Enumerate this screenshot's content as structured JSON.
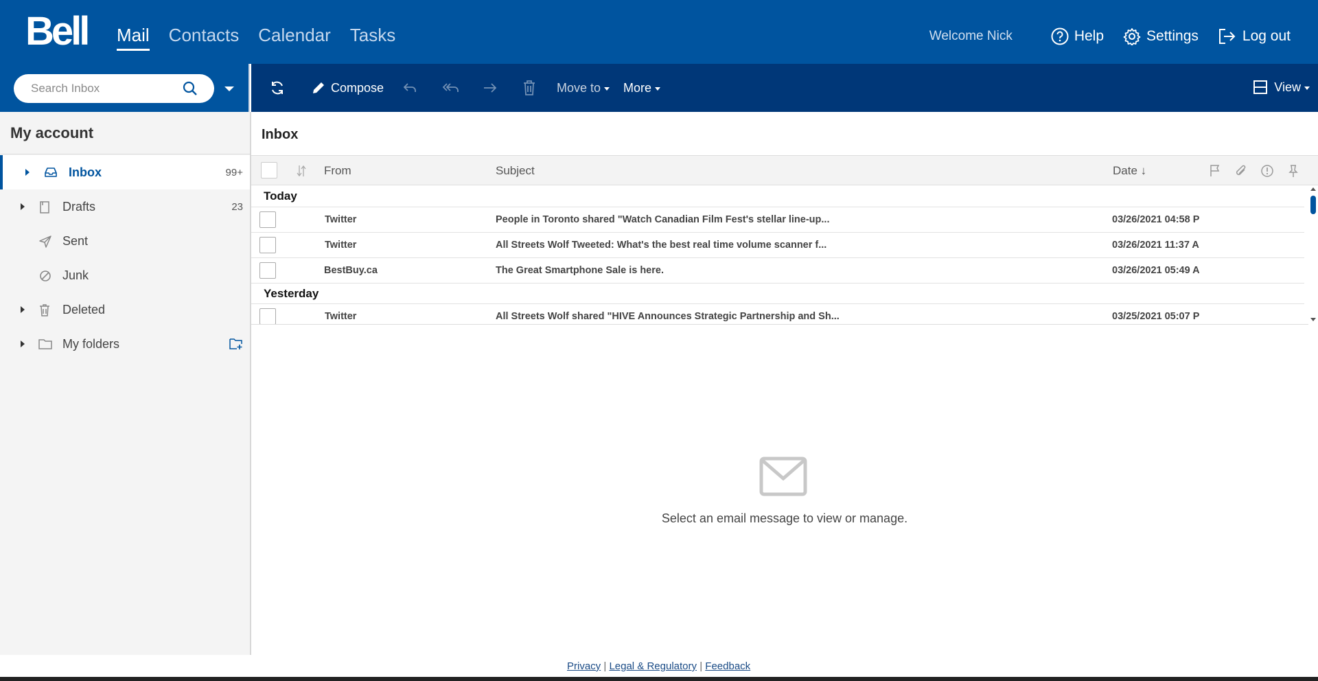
{
  "header": {
    "logo": "Bell",
    "nav": [
      {
        "label": "Mail",
        "active": true
      },
      {
        "label": "Contacts",
        "active": false
      },
      {
        "label": "Calendar",
        "active": false
      },
      {
        "label": "Tasks",
        "active": false
      }
    ],
    "welcome": "Welcome Nick",
    "help": "Help",
    "settings": "Settings",
    "logout": "Log out"
  },
  "search": {
    "placeholder": "Search Inbox",
    "value": ""
  },
  "toolbar": {
    "compose": "Compose",
    "move_to": "Move to",
    "more": "More",
    "view": "View"
  },
  "sidebar": {
    "title": "My account",
    "folders": [
      {
        "label": "Inbox",
        "count": "99+",
        "icon": "inbox-icon",
        "active": true,
        "expandable": true
      },
      {
        "label": "Drafts",
        "count": "23",
        "icon": "drafts-icon",
        "active": false,
        "expandable": true
      },
      {
        "label": "Sent",
        "count": "",
        "icon": "sent-icon",
        "active": false,
        "expandable": false
      },
      {
        "label": "Junk",
        "count": "",
        "icon": "junk-icon",
        "active": false,
        "expandable": false
      },
      {
        "label": "Deleted",
        "count": "",
        "icon": "trash-icon",
        "active": false,
        "expandable": true
      },
      {
        "label": "My folders",
        "count": "",
        "icon": "folder-icon",
        "active": false,
        "expandable": true
      }
    ]
  },
  "mail_list": {
    "title": "Inbox",
    "columns": {
      "from": "From",
      "subject": "Subject",
      "date": "Date ↓"
    },
    "groups": [
      {
        "label": "Today",
        "rows": [
          {
            "from": "Twitter",
            "subject": "People in Toronto shared \"Watch Canadian Film Fest's stellar line-up...",
            "date": "03/26/2021 04:58 P"
          },
          {
            "from": "Twitter",
            "subject": "All Streets Wolf Tweeted: What's the best real time volume scanner f...",
            "date": "03/26/2021 11:37 A"
          },
          {
            "from": "BestBuy.ca",
            "subject": "The Great Smartphone Sale is here.",
            "date": "03/26/2021 05:49 A"
          }
        ]
      },
      {
        "label": "Yesterday",
        "rows": [
          {
            "from": "Twitter",
            "subject": "All Streets Wolf shared \"HIVE Announces Strategic Partnership and Sh...",
            "date": "03/25/2021 05:07 P"
          }
        ]
      }
    ]
  },
  "reading_pane": {
    "empty_message": "Select an email message to view or manage."
  },
  "footer": {
    "privacy": "Privacy",
    "legal": "Legal & Regulatory",
    "feedback": "Feedback",
    "separator": "|"
  },
  "colors": {
    "brand_blue": "#00549f",
    "toolbar_blue": "#003778",
    "active_accent": "#00549f"
  }
}
